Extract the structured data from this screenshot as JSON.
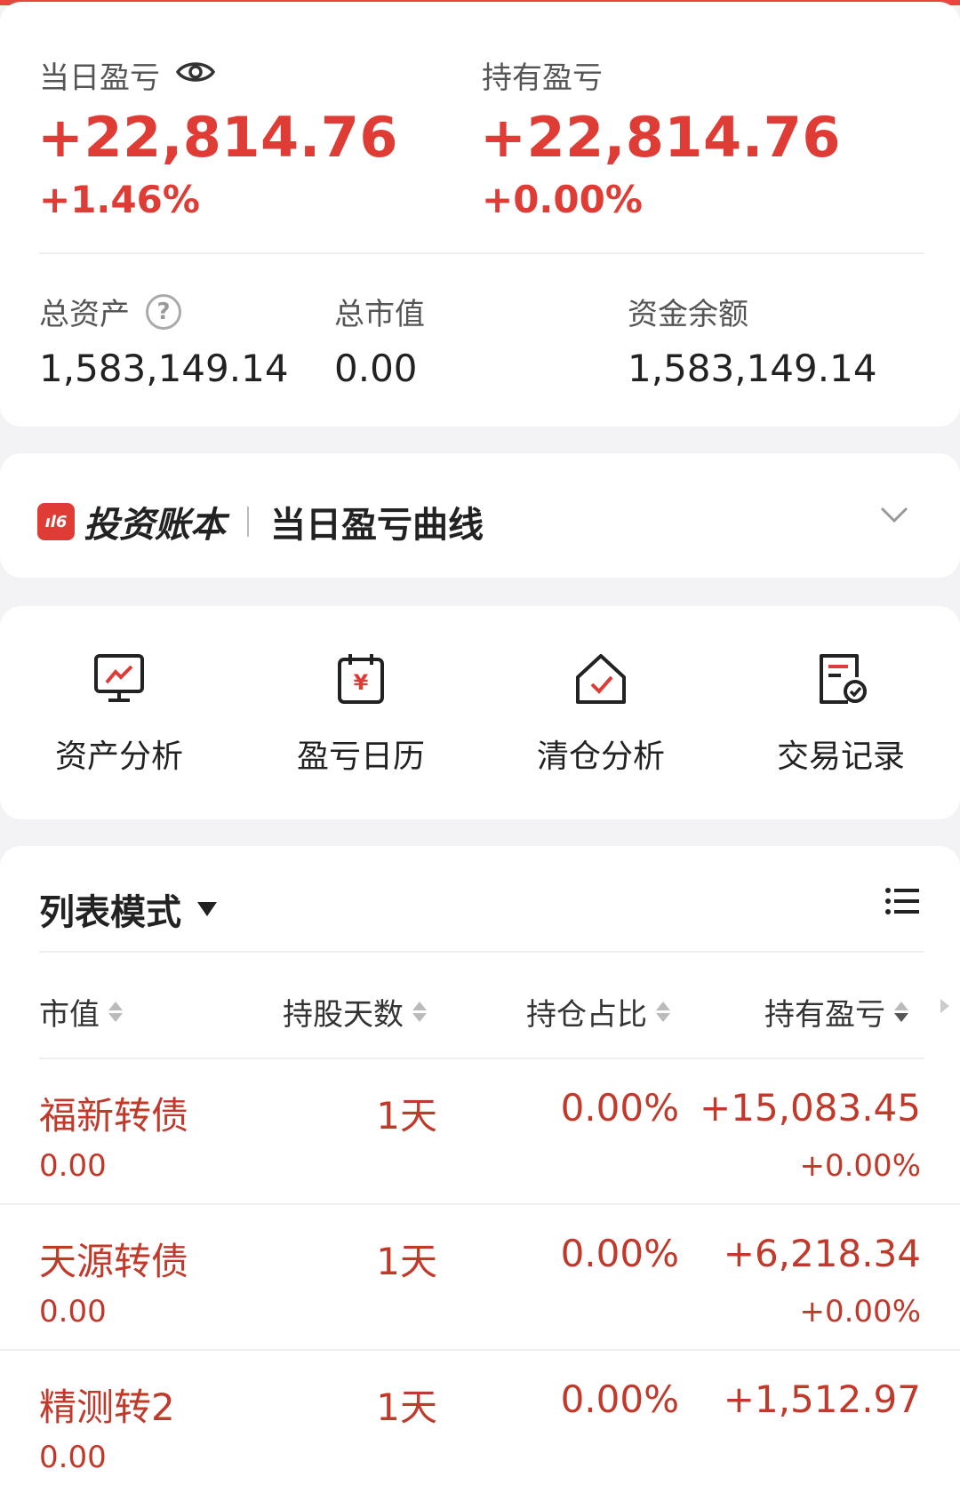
{
  "summary": {
    "daily_label": "当日盈亏",
    "daily_value": "+22,814.76",
    "daily_pct": "+1.46%",
    "holding_label": "持有盈亏",
    "holding_value": "+22,814.76",
    "holding_pct": "+0.00%",
    "total_assets_label": "总资产",
    "total_assets_value": "1,583,149.14",
    "market_value_label": "总市值",
    "market_value_value": "0.00",
    "cash_label": "资金余额",
    "cash_value": "1,583,149.14"
  },
  "ledger": {
    "logo_text": "投资账本",
    "subtitle": "当日盈亏曲线"
  },
  "tools": [
    {
      "label": "资产分析",
      "icon": "monitor-chart-icon"
    },
    {
      "label": "盈亏日历",
      "icon": "calendar-yen-icon"
    },
    {
      "label": "清仓分析",
      "icon": "house-check-icon"
    },
    {
      "label": "交易记录",
      "icon": "document-check-icon"
    }
  ],
  "list": {
    "mode_label": "列表模式",
    "columns": [
      "市值",
      "持股天数",
      "持仓占比",
      "持有盈亏"
    ],
    "rows": [
      {
        "name": "福新转债",
        "market_value": "0.00",
        "days": "1天",
        "ratio": "0.00%",
        "pl": "+15,083.45",
        "pl_pct": "+0.00%"
      },
      {
        "name": "天源转债",
        "market_value": "0.00",
        "days": "1天",
        "ratio": "0.00%",
        "pl": "+6,218.34",
        "pl_pct": "+0.00%"
      },
      {
        "name": "精测转2",
        "market_value": "0.00",
        "days": "1天",
        "ratio": "0.00%",
        "pl": "+1,512.97",
        "pl_pct": ""
      }
    ]
  },
  "colors": {
    "accent_red": "#e03c36",
    "row_red": "#c0392b",
    "background": "#f3f3f5"
  }
}
